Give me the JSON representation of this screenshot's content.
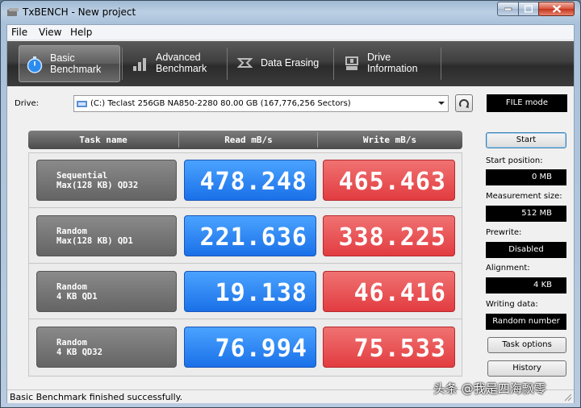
{
  "window": {
    "title": "TxBENCH - New project"
  },
  "menu": [
    "File",
    "View",
    "Help"
  ],
  "toolbar": {
    "tabs": [
      {
        "label": "Basic\nBenchmark",
        "icon": "stopwatch-icon"
      },
      {
        "label": "Advanced\nBenchmark",
        "icon": "bar-chart-icon"
      },
      {
        "label": "Data Erasing",
        "icon": "eraser-icon"
      },
      {
        "label": "Drive\nInformation",
        "icon": "drive-info-icon"
      }
    ]
  },
  "drive": {
    "label": "Drive:",
    "selected": "(C:) Teclast 256GB NA850-2280  80.00 GB (167,776,256 Sectors)",
    "mode": "FILE mode"
  },
  "table": {
    "headers": [
      "Task name",
      "Read mB/s",
      "Write mB/s"
    ],
    "rows": [
      {
        "task1": "Sequential",
        "task2": "Max(128 KB) QD32",
        "read": "478.248",
        "write": "465.463"
      },
      {
        "task1": "Random",
        "task2": "Max(128 KB) QD1",
        "read": "221.636",
        "write": "338.225"
      },
      {
        "task1": "Random",
        "task2": "4 KB QD1",
        "read": "19.138",
        "write": "46.416"
      },
      {
        "task1": "Random",
        "task2": "4 KB QD32",
        "read": "76.994",
        "write": "75.533"
      }
    ]
  },
  "settings": {
    "start_button": "Start",
    "start_position_label": "Start position:",
    "start_position": "0 MB",
    "measurement_size_label": "Measurement size:",
    "measurement_size": "512 MB",
    "prewrite_label": "Prewrite:",
    "prewrite": "Disabled",
    "alignment_label": "Alignment:",
    "alignment": "4 KB",
    "writing_data_label": "Writing data:",
    "writing_data": "Random number",
    "task_options_button": "Task options",
    "history_button": "History"
  },
  "status": {
    "text": "Basic Benchmark finished successfully."
  },
  "watermark": "头条 @我是四海飘零",
  "colors": {
    "read": "#2a86f5",
    "write": "#e85256",
    "toolbar": "#3c3c3c"
  }
}
